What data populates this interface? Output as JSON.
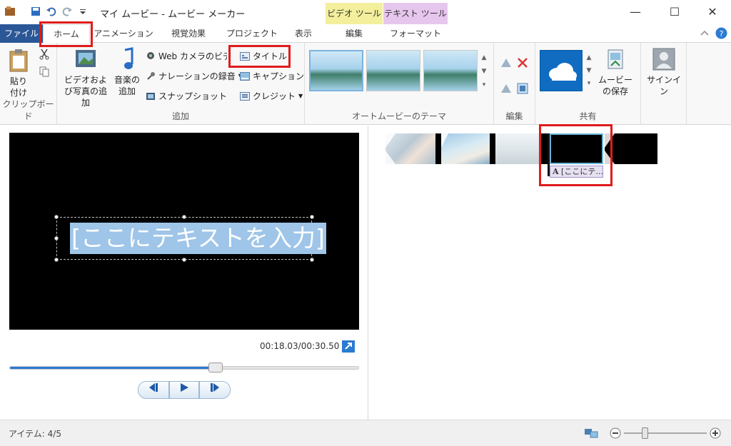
{
  "window": {
    "title": "マイ ムービー - ムービー メーカー",
    "context_video": "ビデオ ツール",
    "context_text": "テキスト ツール",
    "minimize": "—",
    "maximize": "☐",
    "close": "✕"
  },
  "tabs": {
    "file": "ファイル",
    "home": "ホーム",
    "animation": "アニメーション",
    "visual": "視覚効果",
    "project": "プロジェクト",
    "view": "表示",
    "edit": "編集",
    "format": "フォーマット"
  },
  "ribbon": {
    "clipboard": {
      "paste": "貼り付け",
      "group": "クリップボード"
    },
    "add": {
      "add_video_photo": "ビデオおよび写真の追加",
      "add_music": "音楽の追加",
      "webcam": "Web カメラのビデオ",
      "narration": "ナレーションの録音",
      "snapshot": "スナップショット",
      "title": "タイトル",
      "caption": "キャプション",
      "credit": "クレジット",
      "group": "追加"
    },
    "themes": {
      "group": "オートムービーのテーマ"
    },
    "editing": {
      "group": "編集"
    },
    "share": {
      "save_movie": "ムービーの保存",
      "group": "共有"
    },
    "signin": "サインイン"
  },
  "preview": {
    "text": "[ここにテキストを入力]",
    "time": "00:18.03/00:30.50",
    "progress": 0.59
  },
  "storyboard": {
    "caption_tag": "[ここにテ..."
  },
  "status": {
    "items": "アイテム: 4/5"
  },
  "colors": {
    "file_tab": "#2b5797",
    "accent_blue": "#2b79d2",
    "annotation_red": "#e01b1b",
    "context_video": "#f3ef9c",
    "context_text": "#e7c6ee"
  }
}
